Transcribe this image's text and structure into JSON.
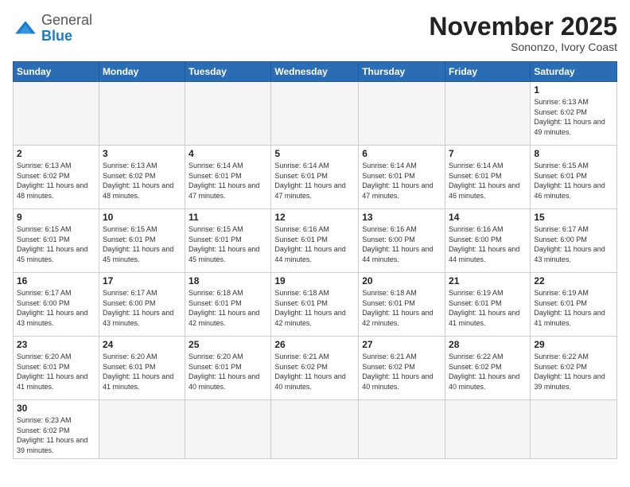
{
  "logo": {
    "general": "General",
    "blue": "Blue"
  },
  "header": {
    "month": "November 2025",
    "location": "Sononzo, Ivory Coast"
  },
  "days_of_week": [
    "Sunday",
    "Monday",
    "Tuesday",
    "Wednesday",
    "Thursday",
    "Friday",
    "Saturday"
  ],
  "weeks": [
    [
      {
        "day": "",
        "empty": true
      },
      {
        "day": "",
        "empty": true
      },
      {
        "day": "",
        "empty": true
      },
      {
        "day": "",
        "empty": true
      },
      {
        "day": "",
        "empty": true
      },
      {
        "day": "",
        "empty": true
      },
      {
        "day": "1",
        "sunrise": "6:13 AM",
        "sunset": "6:02 PM",
        "daylight": "11 hours and 49 minutes."
      }
    ],
    [
      {
        "day": "2",
        "sunrise": "6:13 AM",
        "sunset": "6:02 PM",
        "daylight": "11 hours and 48 minutes."
      },
      {
        "day": "3",
        "sunrise": "6:13 AM",
        "sunset": "6:02 PM",
        "daylight": "11 hours and 48 minutes."
      },
      {
        "day": "4",
        "sunrise": "6:14 AM",
        "sunset": "6:01 PM",
        "daylight": "11 hours and 47 minutes."
      },
      {
        "day": "5",
        "sunrise": "6:14 AM",
        "sunset": "6:01 PM",
        "daylight": "11 hours and 47 minutes."
      },
      {
        "day": "6",
        "sunrise": "6:14 AM",
        "sunset": "6:01 PM",
        "daylight": "11 hours and 47 minutes."
      },
      {
        "day": "7",
        "sunrise": "6:14 AM",
        "sunset": "6:01 PM",
        "daylight": "11 hours and 46 minutes."
      },
      {
        "day": "8",
        "sunrise": "6:15 AM",
        "sunset": "6:01 PM",
        "daylight": "11 hours and 46 minutes."
      }
    ],
    [
      {
        "day": "9",
        "sunrise": "6:15 AM",
        "sunset": "6:01 PM",
        "daylight": "11 hours and 45 minutes."
      },
      {
        "day": "10",
        "sunrise": "6:15 AM",
        "sunset": "6:01 PM",
        "daylight": "11 hours and 45 minutes."
      },
      {
        "day": "11",
        "sunrise": "6:15 AM",
        "sunset": "6:01 PM",
        "daylight": "11 hours and 45 minutes."
      },
      {
        "day": "12",
        "sunrise": "6:16 AM",
        "sunset": "6:01 PM",
        "daylight": "11 hours and 44 minutes."
      },
      {
        "day": "13",
        "sunrise": "6:16 AM",
        "sunset": "6:00 PM",
        "daylight": "11 hours and 44 minutes."
      },
      {
        "day": "14",
        "sunrise": "6:16 AM",
        "sunset": "6:00 PM",
        "daylight": "11 hours and 44 minutes."
      },
      {
        "day": "15",
        "sunrise": "6:17 AM",
        "sunset": "6:00 PM",
        "daylight": "11 hours and 43 minutes."
      }
    ],
    [
      {
        "day": "16",
        "sunrise": "6:17 AM",
        "sunset": "6:00 PM",
        "daylight": "11 hours and 43 minutes."
      },
      {
        "day": "17",
        "sunrise": "6:17 AM",
        "sunset": "6:00 PM",
        "daylight": "11 hours and 43 minutes."
      },
      {
        "day": "18",
        "sunrise": "6:18 AM",
        "sunset": "6:01 PM",
        "daylight": "11 hours and 42 minutes."
      },
      {
        "day": "19",
        "sunrise": "6:18 AM",
        "sunset": "6:01 PM",
        "daylight": "11 hours and 42 minutes."
      },
      {
        "day": "20",
        "sunrise": "6:18 AM",
        "sunset": "6:01 PM",
        "daylight": "11 hours and 42 minutes."
      },
      {
        "day": "21",
        "sunrise": "6:19 AM",
        "sunset": "6:01 PM",
        "daylight": "11 hours and 41 minutes."
      },
      {
        "day": "22",
        "sunrise": "6:19 AM",
        "sunset": "6:01 PM",
        "daylight": "11 hours and 41 minutes."
      }
    ],
    [
      {
        "day": "23",
        "sunrise": "6:20 AM",
        "sunset": "6:01 PM",
        "daylight": "11 hours and 41 minutes."
      },
      {
        "day": "24",
        "sunrise": "6:20 AM",
        "sunset": "6:01 PM",
        "daylight": "11 hours and 41 minutes."
      },
      {
        "day": "25",
        "sunrise": "6:20 AM",
        "sunset": "6:01 PM",
        "daylight": "11 hours and 40 minutes."
      },
      {
        "day": "26",
        "sunrise": "6:21 AM",
        "sunset": "6:02 PM",
        "daylight": "11 hours and 40 minutes."
      },
      {
        "day": "27",
        "sunrise": "6:21 AM",
        "sunset": "6:02 PM",
        "daylight": "11 hours and 40 minutes."
      },
      {
        "day": "28",
        "sunrise": "6:22 AM",
        "sunset": "6:02 PM",
        "daylight": "11 hours and 40 minutes."
      },
      {
        "day": "29",
        "sunrise": "6:22 AM",
        "sunset": "6:02 PM",
        "daylight": "11 hours and 39 minutes."
      }
    ],
    [
      {
        "day": "30",
        "sunrise": "6:23 AM",
        "sunset": "6:02 PM",
        "daylight": "11 hours and 39 minutes."
      },
      {
        "day": "",
        "empty": true
      },
      {
        "day": "",
        "empty": true
      },
      {
        "day": "",
        "empty": true
      },
      {
        "day": "",
        "empty": true
      },
      {
        "day": "",
        "empty": true
      },
      {
        "day": "",
        "empty": true
      }
    ]
  ]
}
